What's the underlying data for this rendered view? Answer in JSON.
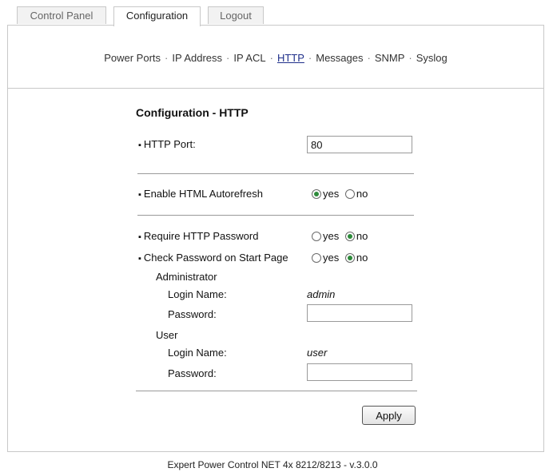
{
  "tabs": [
    {
      "label": "Control Panel"
    },
    {
      "label": "Configuration"
    },
    {
      "label": "Logout"
    }
  ],
  "nav": {
    "items": [
      "Power Ports",
      "IP Address",
      "IP ACL",
      "HTTP",
      "Messages",
      "SNMP",
      "Syslog"
    ],
    "current": "HTTP",
    "separator": "·"
  },
  "form": {
    "title": "Configuration - HTTP",
    "http_port_label": "HTTP Port:",
    "http_port_value": "80",
    "autorefresh_label": "Enable HTML Autorefresh",
    "autorefresh_value": "yes",
    "require_password_label": "Require HTTP Password",
    "require_password_value": "no",
    "check_start_page_label": "Check Password on Start Page",
    "check_start_page_value": "no",
    "yes_label": "yes",
    "no_label": "no",
    "administrator_label": "Administrator",
    "admin_login_label": "Login Name:",
    "admin_login_value": "admin",
    "admin_password_label": "Password:",
    "user_label": "User",
    "user_login_label": "Login Name:",
    "user_login_value": "user",
    "user_password_label": "Password:",
    "apply_label": "Apply"
  },
  "footer": "Expert Power Control NET 4x 8212/8213 - v.3.0.0",
  "colors": {
    "radio_checked": "#2d8a3a",
    "border": "#c8c8c8",
    "link_current": "#1f2f8a"
  }
}
